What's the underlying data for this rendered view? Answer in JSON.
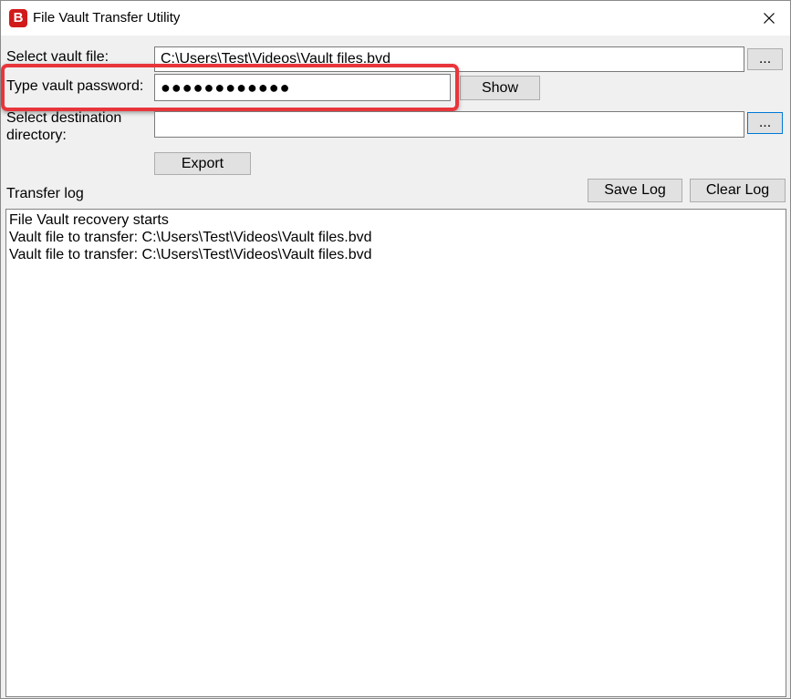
{
  "window": {
    "title": "File Vault Transfer Utility",
    "icon_letter": "B",
    "accent_color": "#d11a1a"
  },
  "vault_file": {
    "label": "Select vault file:",
    "value": "C:\\Users\\Test\\Videos\\Vault files.bvd",
    "browse_label": "..."
  },
  "password": {
    "label": "Type vault password:",
    "masked_value": "●●●●●●●●●●●●",
    "show_label": "Show",
    "highlight_color": "#e8353b"
  },
  "destination": {
    "label_line1": "Select destination",
    "label_line2": "directory:",
    "value": "",
    "browse_label": "..."
  },
  "export_label": "Export",
  "log": {
    "label": "Transfer log",
    "save_label": "Save Log",
    "clear_label": "Clear Log",
    "lines": [
      "File Vault recovery starts",
      "Vault file to transfer: C:\\Users\\Test\\Videos\\Vault files.bvd",
      "Vault file to transfer: C:\\Users\\Test\\Videos\\Vault files.bvd"
    ]
  }
}
